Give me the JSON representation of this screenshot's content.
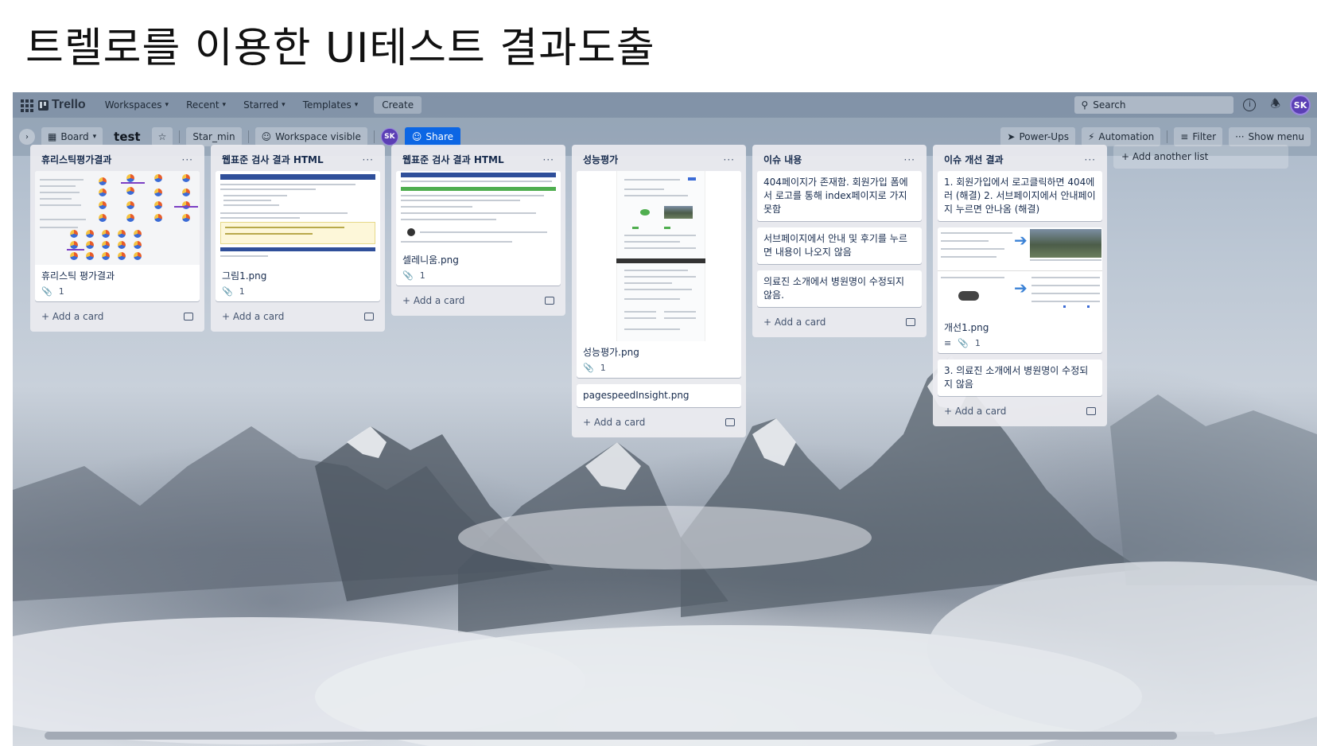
{
  "slide": {
    "title": "트렐로를 이용한 UI테스트 결과도출"
  },
  "topbar": {
    "logo": "Trello",
    "nav": [
      "Workspaces",
      "Recent",
      "Starred",
      "Templates"
    ],
    "create": "Create",
    "search_placeholder": "Search",
    "avatar": "SK"
  },
  "boardbar": {
    "view": "Board",
    "name": "test",
    "workspace": "Star_min",
    "visibility": "Workspace visible",
    "member": "SK",
    "share": "Share",
    "powerups": "Power-Ups",
    "automation": "Automation",
    "filter": "Filter",
    "show_menu": "Show menu"
  },
  "lists": [
    {
      "title": "휴리스틱평가결과",
      "cards": [
        {
          "title": "휴리스틱 평가결과",
          "attachments": "1"
        }
      ],
      "add_card": "Add a card"
    },
    {
      "title": "웹표준 검사 결과 HTML",
      "cards": [
        {
          "title": "그림1.png",
          "attachments": "1"
        }
      ],
      "add_card": "Add a card"
    },
    {
      "title": "웹표준 검사 결과 HTML",
      "cards": [
        {
          "title": "셀레니움.png",
          "attachments": "1"
        }
      ],
      "add_card": "Add a card"
    },
    {
      "title": "성능평가",
      "cards": [
        {
          "title": "성능평가.png",
          "attachments": "1"
        },
        {
          "title": "pagespeedInsight.png"
        }
      ],
      "add_card": "Add a card"
    },
    {
      "title": "이슈 내용",
      "cards": [
        {
          "title": "404페이지가 존재함. 회원가입 폼에서 로고를 통해 index페이지로 가지 못함"
        },
        {
          "title": "서브페이지에서 안내 및 후기를 누르면 내용이 나오지 않음"
        },
        {
          "title": "의료진 소개에서 병원명이 수정되지 않음."
        }
      ],
      "add_card": "Add a card"
    },
    {
      "title": "이슈 개선 결과",
      "cards": [
        {
          "title": "1. 회원가입에서 로고클릭하면 404에러 (해결) 2. 서브페이지에서 안내페이지 누르면 안나옴 (해결)"
        },
        {
          "title": "개선1.png",
          "attachments": "1"
        },
        {
          "title": "3. 의료진 소개에서 병원명이 수정되지 않음"
        }
      ],
      "add_card": "Add a card"
    }
  ],
  "add_list": "Add another list",
  "colors": {
    "share": "#0c66e4",
    "avatar": "#5b3fb5",
    "list_bg": "#ebecf0"
  },
  "icons": [
    "apps-icon",
    "trello-logo-icon",
    "chevron-down-icon",
    "search-icon",
    "info-icon",
    "bell-icon",
    "star-icon",
    "board-icon",
    "people-icon",
    "powerups-icon",
    "automation-icon",
    "filter-icon",
    "more-icon",
    "attachment-icon",
    "description-icon",
    "plus-icon",
    "template-icon"
  ]
}
